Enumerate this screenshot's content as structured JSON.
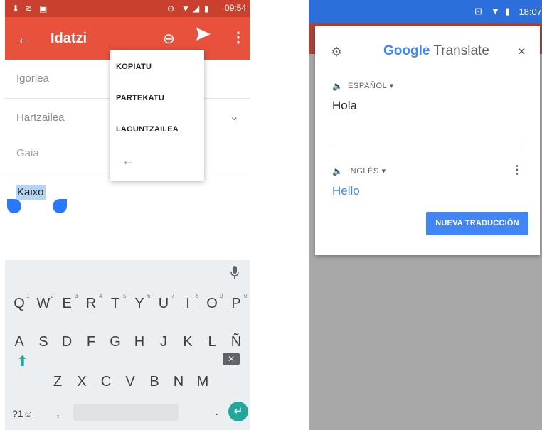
{
  "left_phone": {
    "status": {
      "time": "09:54",
      "icons": [
        "download-icon",
        "wifi-icon",
        "image-icon",
        "minus-circle-icon",
        "signal-icon",
        "battery-icon"
      ]
    },
    "appbar": {
      "back_glyph": "←",
      "title": "Idatzi",
      "attach_glyph": "⊖",
      "more_glyph": "⋮"
    },
    "fields": {
      "from_label": "Igorlea",
      "to_label": "Hartzailea",
      "subject_placeholder": "Gaia",
      "chev": "⌄"
    },
    "body_text": "Kaixo",
    "popup_menu": {
      "items": [
        "KOPIATU",
        "PARTEKATU",
        "LAGUNTZAILEA"
      ],
      "back_glyph": "←"
    },
    "keyboard": {
      "row1": [
        "Q",
        "W",
        "E",
        "R",
        "T",
        "Y",
        "U",
        "I",
        "O",
        "P"
      ],
      "row1_numbers": [
        "1",
        "2",
        "3",
        "4",
        "5",
        "6",
        "7",
        "8",
        "9",
        "0"
      ],
      "row2": [
        "A",
        "S",
        "D",
        "F",
        "G",
        "H",
        "J",
        "K",
        "L",
        "Ñ"
      ],
      "row3": [
        "Z",
        "X",
        "C",
        "V",
        "B",
        "N",
        "M"
      ],
      "symbols_key": "?1☺",
      "comma_key": ",",
      "period_key": ".",
      "enter_glyph": "↵",
      "shift_glyph": "⬆",
      "backspace_glyph": "✕",
      "mic_glyph": "🎙"
    },
    "colors": {
      "appbar": "#e8513b",
      "status": "#c9412e",
      "selection": "#b3d4f5",
      "handle": "#2979ff",
      "accent": "#26a69a"
    }
  },
  "right_phone": {
    "status": {
      "time": "18:07",
      "icons": [
        "vibrate-icon",
        "wifi-icon",
        "battery-icon"
      ]
    },
    "card": {
      "settings_glyph": "⚙",
      "title_google": "Google",
      "title_translate": "Translate",
      "close_glyph": "×",
      "source_lang": "ESPAÑOL",
      "source_text": "Hola",
      "target_lang": "INGLÉS",
      "target_text": "Hello",
      "more_glyph": "⋮",
      "speaker_glyph": "🔈",
      "dropdown_glyph": "▾",
      "new_translation_button": "NUEVA TRADUCCIÓN"
    },
    "colors": {
      "status": "#2c6fdb",
      "accent": "#4285f4",
      "scrim": "#a8a8a8"
    }
  }
}
